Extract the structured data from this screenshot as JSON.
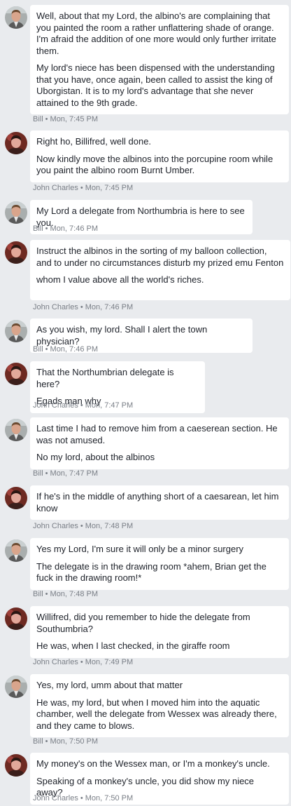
{
  "separator": "•",
  "messages": [
    {
      "sender": "Bill",
      "avatar": "bill-avatar",
      "time": "Mon, 7:45 PM",
      "paragraphs": [
        "Well, about that my Lord, the albino's are complaining that you painted the room a rather unflattering shade of orange. I'm afraid the addition of one more would only further irritate them.",
        "My lord's niece has been dispensed with the understanding that you have, once again, been called to assist the king of Uborgistan. It is to my lord's advantage that she never attained to the 9th grade."
      ]
    },
    {
      "sender": "John Charles",
      "avatar": "john-charles-avatar",
      "time": "Mon, 7:45 PM",
      "paragraphs": [
        "Right ho, Billifred, well done.",
        "Now kindly move the albinos into the porcupine room while you paint the albino room Burnt Umber."
      ]
    },
    {
      "sender": "Bill",
      "avatar": "bill-avatar",
      "time": "Mon, 7:46 PM",
      "paragraphs": [
        "My Lord a delegate from Northumbria is here to see you."
      ]
    },
    {
      "sender": "John Charles",
      "avatar": "john-charles-avatar",
      "time": "Mon, 7:46 PM",
      "paragraphs": [
        "Instruct the albinos in the sorting of my balloon collection, and to under no circumstances disturb my prized emu Fenton",
        "whom I value above all the world's riches."
      ]
    },
    {
      "sender": "Bill",
      "avatar": "bill-avatar",
      "time": "Mon, 7:46 PM",
      "paragraphs": [
        "As you wish, my lord. Shall I alert the town physician?"
      ]
    },
    {
      "sender": "John Charles",
      "avatar": "john-charles-avatar",
      "time": "Mon, 7:47 PM",
      "paragraphs": [
        "That the Northumbrian delegate is here?",
        "Egads man why"
      ]
    },
    {
      "sender": "Bill",
      "avatar": "bill-avatar",
      "time": "Mon, 7:47 PM",
      "paragraphs": [
        "Last time I had to remove him from a caeserean section. He was not amused.",
        "No my lord, about the albinos"
      ]
    },
    {
      "sender": "John Charles",
      "avatar": "john-charles-avatar",
      "time": "Mon, 7:48 PM",
      "paragraphs": [
        "If he's in the middle of anything short of a caesarean, let him know"
      ]
    },
    {
      "sender": "Bill",
      "avatar": "bill-avatar",
      "time": "Mon, 7:48 PM",
      "paragraphs": [
        "Yes my Lord, I'm sure it will only be a minor surgery",
        "The delegate is in the drawing room *ahem, Brian get the fuck in the drawing room!*"
      ]
    },
    {
      "sender": "John Charles",
      "avatar": "john-charles-avatar",
      "time": "Mon, 7:49 PM",
      "paragraphs": [
        "Willifred, did you remember to hide the delegate from Southumbria?",
        "He was, when I last checked, in the giraffe room"
      ]
    },
    {
      "sender": "Bill",
      "avatar": "bill-avatar",
      "time": "Mon, 7:50 PM",
      "paragraphs": [
        "Yes, my lord, umm about that matter",
        "He was, my lord, but when I moved him into the aquatic chamber, well the delegate from Wessex was already there, and they came to blows."
      ]
    },
    {
      "sender": "John Charles",
      "avatar": "john-charles-avatar",
      "time": "Mon, 7:50 PM",
      "paragraphs": [
        "My money's on the Wessex man, or I'm a monkey's uncle.",
        "Speaking of a monkey's uncle, you did show my niece away?"
      ]
    }
  ]
}
